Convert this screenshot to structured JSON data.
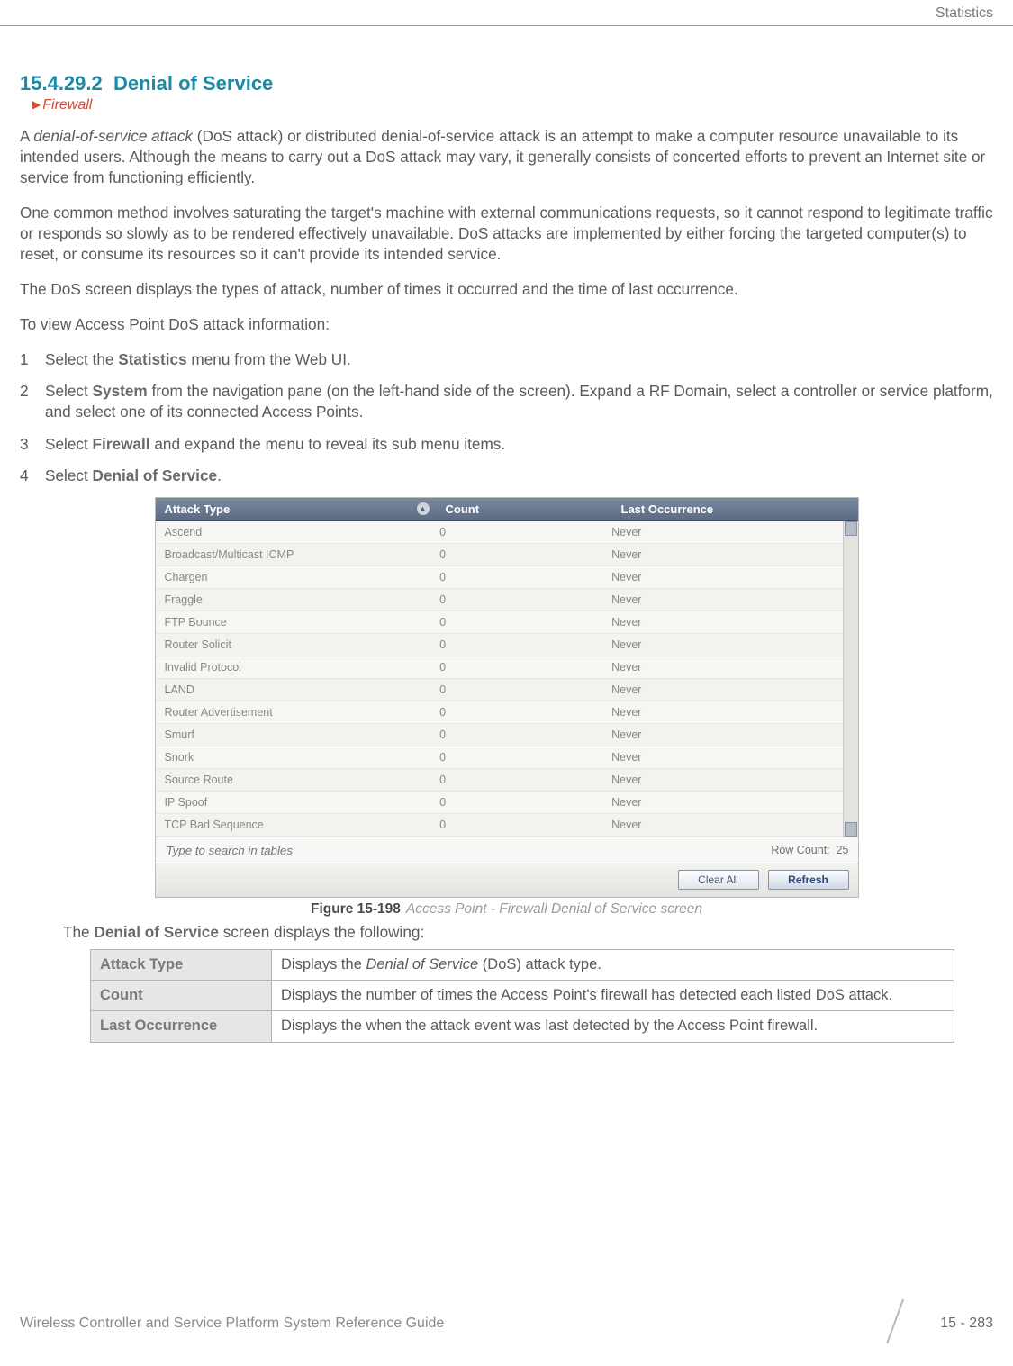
{
  "header": {
    "section": "Statistics"
  },
  "title": {
    "number": "15.4.29.2",
    "text": "Denial of Service"
  },
  "breadcrumb": {
    "label": "Firewall"
  },
  "paragraphs": {
    "p1_a": "A ",
    "p1_em": "denial-of-service attack",
    "p1_b": " (DoS attack) or distributed denial-of-service attack is an attempt to make a computer resource unavailable to its intended users. Although the means to carry out a DoS attack may vary, it generally consists of concerted efforts to prevent an Internet site or service from functioning efficiently.",
    "p2": "One common method involves saturating the target's machine with external communications requests, so it cannot respond to legitimate traffic or responds so slowly as to be rendered effectively unavailable. DoS attacks are implemented by either forcing the targeted computer(s) to reset, or consume its resources so it can't provide its intended service.",
    "p3": "The DoS screen displays the types of attack, number of times it occurred and the time of last occurrence.",
    "p4": "To view Access Point DoS attack information:"
  },
  "steps": {
    "s1_a": "Select the ",
    "s1_bold": "Statistics",
    "s1_b": " menu from the Web UI.",
    "s2_a": "Select ",
    "s2_bold": "System",
    "s2_b": " from the navigation pane (on the left-hand side of the screen). Expand a RF Domain, select a controller or service platform, and select one of its connected Access Points.",
    "s3_a": "Select ",
    "s3_bold": "Firewall",
    "s3_b": " and expand the menu to reveal its sub menu items.",
    "s4_a": "Select ",
    "s4_bold": "Denial of Service",
    "s4_b": "."
  },
  "screenshot": {
    "headers": {
      "c1": "Attack Type",
      "c2": "Count",
      "c3": "Last Occurrence"
    },
    "rows": [
      {
        "c1": "Ascend",
        "c2": "0",
        "c3": "Never"
      },
      {
        "c1": "Broadcast/Multicast ICMP",
        "c2": "0",
        "c3": "Never"
      },
      {
        "c1": "Chargen",
        "c2": "0",
        "c3": "Never"
      },
      {
        "c1": "Fraggle",
        "c2": "0",
        "c3": "Never"
      },
      {
        "c1": "FTP Bounce",
        "c2": "0",
        "c3": "Never"
      },
      {
        "c1": "Router Solicit",
        "c2": "0",
        "c3": "Never"
      },
      {
        "c1": "Invalid Protocol",
        "c2": "0",
        "c3": "Never"
      },
      {
        "c1": "LAND",
        "c2": "0",
        "c3": "Never"
      },
      {
        "c1": "Router Advertisement",
        "c2": "0",
        "c3": "Never"
      },
      {
        "c1": "Smurf",
        "c2": "0",
        "c3": "Never"
      },
      {
        "c1": "Snork",
        "c2": "0",
        "c3": "Never"
      },
      {
        "c1": "Source Route",
        "c2": "0",
        "c3": "Never"
      },
      {
        "c1": "IP Spoof",
        "c2": "0",
        "c3": "Never"
      },
      {
        "c1": "TCP Bad Sequence",
        "c2": "0",
        "c3": "Never"
      }
    ],
    "search_placeholder": "Type to search in tables",
    "rowcount_label": "Row Count:",
    "rowcount_value": "25",
    "buttons": {
      "clear": "Clear All",
      "refresh": "Refresh"
    }
  },
  "figure": {
    "num": "Figure 15-198",
    "caption": "Access Point - Firewall Denial of Service screen"
  },
  "followup": {
    "a": "The ",
    "bold": "Denial of Service",
    "b": " screen displays the following:"
  },
  "reftable": {
    "r1": {
      "label": "Attack Type",
      "text_a": "Displays the ",
      "text_em": "Denial of Service",
      "text_b": " (DoS) attack type."
    },
    "r2": {
      "label": "Count",
      "text": "Displays the number of times the Access Point's firewall has detected each listed DoS attack."
    },
    "r3": {
      "label": "Last Occurrence",
      "text": "Displays the when the attack event was last detected by the Access Point firewall."
    }
  },
  "footer": {
    "left": "Wireless Controller and Service Platform System Reference Guide",
    "right": "15 - 283"
  }
}
